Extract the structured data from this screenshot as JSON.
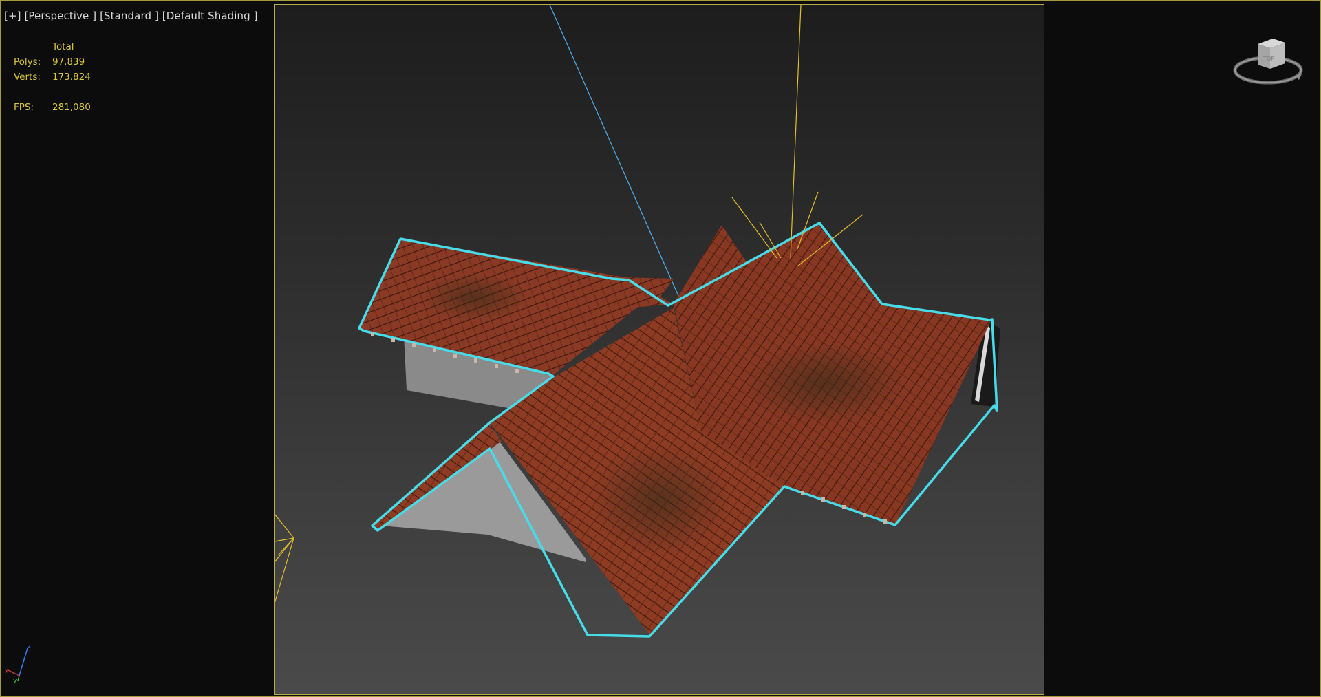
{
  "viewport": {
    "menu": {
      "plus_label": "[+]",
      "view_label": "[Perspective ]",
      "standard_label": "[Standard ]",
      "shading_label": "[Default Shading ]"
    },
    "stats": {
      "header": "Total",
      "polys_label": "Polys:",
      "polys_value": "97.839",
      "verts_label": "Verts:",
      "verts_value": "173.824",
      "fps_label": "FPS:",
      "fps_value": "281,080"
    },
    "viewcube_face": "TOP"
  },
  "colors": {
    "selection_outline": "#46dcea",
    "roof_tile": "#8a3a24",
    "light_rays": "#e2c02a",
    "camera_line": "#4fa8e6",
    "safe_frame": "#b8ad49",
    "stats_text": "#d8c73a"
  },
  "icons": {
    "viewcube": "viewcube-icon",
    "axis_tripod": "xyz-axis-icon"
  }
}
